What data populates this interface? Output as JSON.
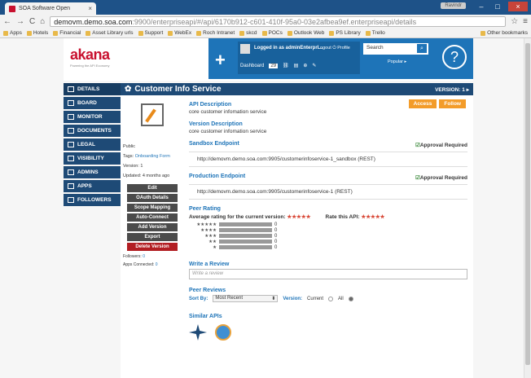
{
  "browser": {
    "tab_title": "SOA Software Open",
    "user_badge": "Ravindr",
    "url_host": "demovm.demo.soa.com",
    "url_path": ":9900/enterpriseapi/#/api/6170b912-c601-410f-95a0-03e2afbea9ef.enterpriseapi/details",
    "bookmarks": [
      "Apps",
      "Hotels",
      "Financial",
      "Asset Library urls",
      "Support",
      "WebEx",
      "Roch Intranet",
      "skcd",
      "POCs",
      "Outlook Web",
      "PS Library",
      "Trello",
      "Other bookmarks"
    ]
  },
  "header": {
    "logo": "akana",
    "logo_tag": "Powering the API Economy",
    "user_text": "Logged in as adminEnterpri...",
    "logout": "Logout",
    "profile": "Profile",
    "dashboard": "Dashboard",
    "dashboard_count": "29",
    "search_placeholder": "Search",
    "popular": "Popular ▸",
    "help": "?"
  },
  "nav": {
    "items": [
      "Details",
      "Board",
      "Monitor",
      "Documents",
      "Legal",
      "Visibility",
      "Admins",
      "Apps",
      "Followers"
    ]
  },
  "service": {
    "title": "Customer Info Service",
    "version_label": "VERSION: 1 ▸",
    "access": "Access",
    "follow": "Follow",
    "visibility": "Public",
    "tags_label": "Tags:",
    "tags": "Onboarding Form",
    "version": "Version: 1",
    "updated": "Updated: 4 months ago",
    "actions": [
      "Edit",
      "OAuth Details",
      "Scope Mapping",
      "Auto-Connect",
      "Add Version",
      "Export",
      "Delete Version"
    ],
    "followers_label": "Followers:",
    "followers": "0",
    "apps_label": "Apps Connected:",
    "apps": "0",
    "api_desc_label": "API Description",
    "api_desc": "core customer infomation service",
    "ver_desc_label": "Version Description",
    "ver_desc": "core customer infomation service",
    "sandbox_label": "Sandbox Endpoint",
    "sandbox_approval": "Approval Required",
    "sandbox_url": "http://demovm.demo.soa.com:9905/customerinfoservice-1_sandbox (REST)",
    "prod_label": "Production Endpoint",
    "prod_approval": "Approval Required",
    "prod_url": "http://demovm.demo.soa.com:9905/customerinfoservice-1 (REST)",
    "rating_label": "Peer Rating",
    "avg_label": "Average rating for the current version:",
    "rate_label": "Rate this API:",
    "stars": "★★★★★",
    "rating_rows": [
      {
        "stars": "★★★★★",
        "count": "0"
      },
      {
        "stars": "★★★★",
        "count": "0"
      },
      {
        "stars": "★★★",
        "count": "0"
      },
      {
        "stars": "★★",
        "count": "0"
      },
      {
        "stars": "★",
        "count": "0"
      }
    ],
    "write_review_label": "Write a Review",
    "write_review_placeholder": "Write a review",
    "peer_reviews_label": "Peer Reviews",
    "sort_label": "Sort By:",
    "sort_value": "Most Recent",
    "version_filter_label": "Version:",
    "current": "Current",
    "all": "All",
    "similar_label": "Similar APIs"
  }
}
